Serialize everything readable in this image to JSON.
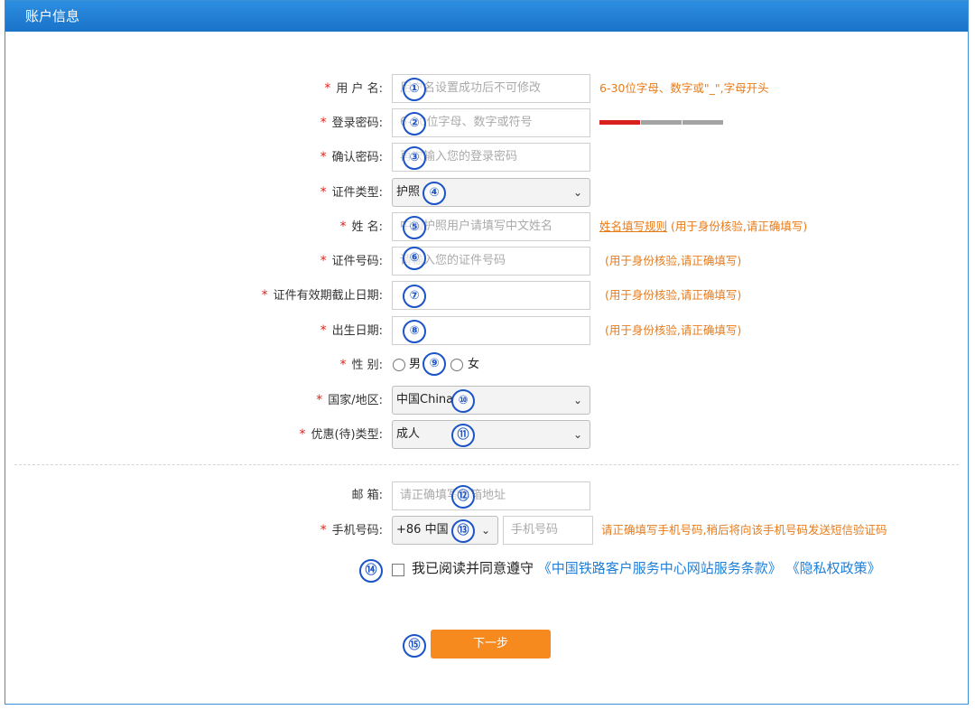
{
  "header": {
    "title": "账户信息"
  },
  "form": {
    "username": {
      "label": "用 户 名:",
      "placeholder": "用户名设置成功后不可修改",
      "hint": "6-30位字母、数字或\"_\",字母开头"
    },
    "password": {
      "label": "登录密码:",
      "placeholder": "6-20位字母、数字或符号"
    },
    "confirm_password": {
      "label": "确认密码:",
      "placeholder": "再次输入您的登录密码"
    },
    "id_type": {
      "label": "证件类型:",
      "value": "护照"
    },
    "name": {
      "label": "姓 名:",
      "placeholder": "中国护照用户请填写中文姓名",
      "link": "姓名填写规则",
      "hint": "(用于身份核验,请正确填写)"
    },
    "id_number": {
      "label": "证件号码:",
      "placeholder": "请输入您的证件号码",
      "hint": "(用于身份核验,请正确填写)"
    },
    "id_expiry": {
      "label": "证件有效期截止日期:",
      "hint": "(用于身份核验,请正确填写)"
    },
    "birth_date": {
      "label": "出生日期:",
      "hint": "(用于身份核验,请正确填写)"
    },
    "gender": {
      "label": "性 别:",
      "male": "男",
      "female": "女"
    },
    "country": {
      "label": "国家/地区:",
      "value": "中国China"
    },
    "discount_type": {
      "label": "优惠(待)类型:",
      "value": "成人"
    },
    "email": {
      "label": "邮 箱:",
      "placeholder": "请正确填写邮箱地址"
    },
    "phone": {
      "label": "手机号码:",
      "code": "+86 中国",
      "placeholder": "手机号码",
      "hint": "请正确填写手机号码,稍后将向该手机号码发送短信验证码"
    },
    "agreement": {
      "text": "我已阅读并同意遵守",
      "terms": "《中国铁路客户服务中心网站服务条款》",
      "privacy": "《隐私权政策》"
    },
    "next_button": "下一步"
  },
  "required_mark": "*",
  "annotations": [
    "①",
    "②",
    "③",
    "④",
    "⑤",
    "⑥",
    "⑦",
    "⑧",
    "⑨",
    "⑩",
    "⑪",
    "⑫",
    "⑬",
    "⑭",
    "⑮"
  ],
  "colors": {
    "header": "#1a73c9",
    "required": "#e3231b",
    "hint": "#e77b1a",
    "link": "#1f7fd8",
    "button": "#f68a1f",
    "annotation": "#1c54c8"
  },
  "password_strength": {
    "level": 1,
    "of": 3
  }
}
